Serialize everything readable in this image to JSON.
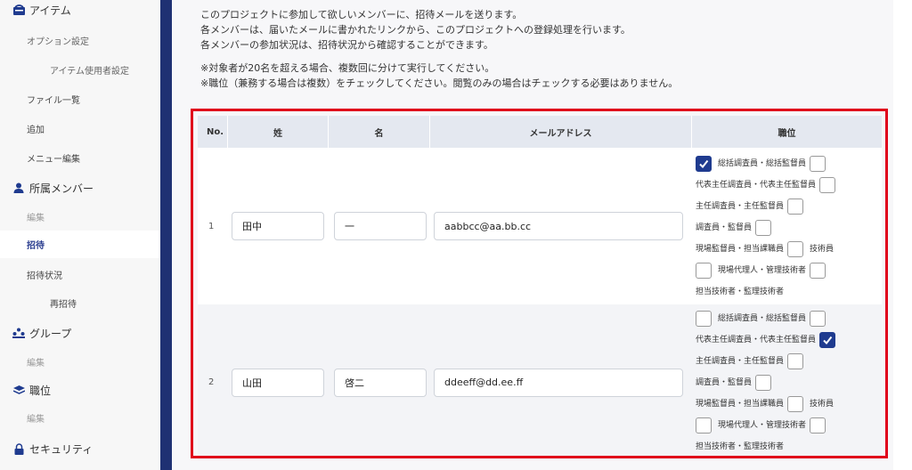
{
  "sidebar": {
    "items": [
      {
        "label": "アイテム"
      },
      {
        "label": "オプション設定"
      },
      {
        "label": "アイテム使用者設定"
      },
      {
        "label": "ファイル一覧"
      },
      {
        "label": "追加"
      },
      {
        "label": "メニュー編集"
      },
      {
        "label": "所属メンバー"
      },
      {
        "label": "編集"
      },
      {
        "label": "招待"
      },
      {
        "label": "招待状況"
      },
      {
        "label": "再招待"
      },
      {
        "label": "グループ"
      },
      {
        "label": "編集"
      },
      {
        "label": "職位"
      },
      {
        "label": "編集"
      },
      {
        "label": "セキュリティ"
      }
    ],
    "icons": {
      "item": "item-icon",
      "members": "person-icon",
      "group": "group-icon",
      "position": "layers-icon",
      "security": "lock-icon"
    }
  },
  "description": {
    "line1": "このプロジェクトに参加して欲しいメンバーに、招待メールを送ります。",
    "line2": "各メンバーは、届いたメールに書かれたリンクから、このプロジェクトへの登録処理を行います。",
    "line3": "各メンバーの参加状況は、招待状況から確認することができます。",
    "note1": "※対象者が20名を超える場合、複数回に分けて実行してください。",
    "note2": "※職位（兼務する場合は複数）をチェックしてください。閲覧のみの場合はチェックする必要はありません。"
  },
  "table": {
    "headers": {
      "no": "No.",
      "sei": "姓",
      "mei": "名",
      "mail": "メールアドレス",
      "position": "職位"
    },
    "rows": [
      {
        "no": "1",
        "sei": "田中",
        "mei": "一",
        "mail": "aabbcc@aa.bb.cc"
      },
      {
        "no": "2",
        "sei": "山田",
        "mei": "啓二",
        "mail": "ddeeff@dd.ee.ff"
      }
    ],
    "positions": {
      "p1": "総括調査員・総括監督員",
      "p2": "代表主任調査員・代表主任監督員",
      "p3": "主任調査員・主任監督員",
      "p4": "調査員・監督員",
      "p5": "現場監督員・担当課職員",
      "p6": "技術員",
      "p7": "現場代理人・管理技術者",
      "p8": "担当技術者・監理技術者"
    }
  },
  "colors": {
    "accent": "#1f3b8f",
    "sidebar_active_text": "#2a3d8f",
    "highlight": "#e0001b",
    "nav_strip": "#1f3173"
  }
}
